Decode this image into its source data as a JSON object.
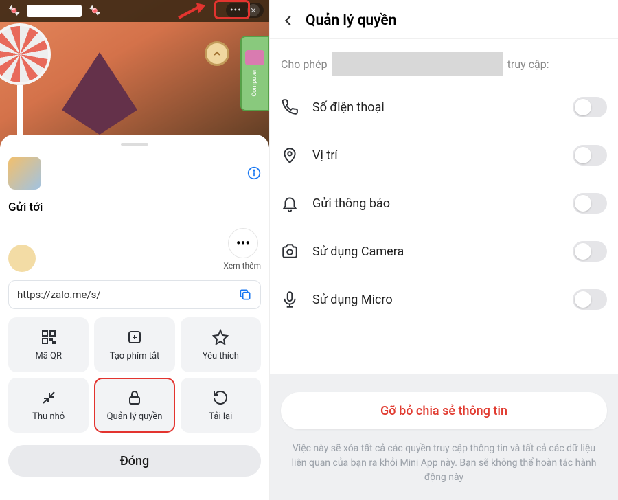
{
  "left": {
    "top_pill": {
      "menu": "•••",
      "close": "✕"
    },
    "side_tab_label": "Computer",
    "sheet": {
      "send_title": "Gửi tới",
      "more_label": "Xem thêm",
      "link_text": "https://zalo.me/s/",
      "tiles": [
        {
          "label": "Mã QR",
          "icon": "qr"
        },
        {
          "label": "Tạo phím tắt",
          "icon": "add-shortcut"
        },
        {
          "label": "Yêu thích",
          "icon": "star"
        },
        {
          "label": "Thu nhỏ",
          "icon": "minimize"
        },
        {
          "label": "Quản lý quyền",
          "icon": "lock"
        },
        {
          "label": "Tải lại",
          "icon": "reload"
        }
      ],
      "close_label": "Đóng"
    }
  },
  "right": {
    "title": "Quản lý quyền",
    "subtitle_prefix": "Cho phép",
    "subtitle_suffix": "truy cập:",
    "permissions": [
      {
        "label": "Số điện thoại",
        "icon": "phone",
        "on": false
      },
      {
        "label": "Vị trí",
        "icon": "location",
        "on": false
      },
      {
        "label": "Gửi thông báo",
        "icon": "bell",
        "on": false
      },
      {
        "label": "Sử dụng Camera",
        "icon": "camera",
        "on": false
      },
      {
        "label": "Sử dụng Micro",
        "icon": "mic",
        "on": false
      }
    ],
    "remove_label": "Gỡ bỏ chia sẻ thông tin",
    "disclaimer": "Việc này sẽ xóa tất cả các quyền truy cập thông tin và tất cả các dữ liệu liên quan của bạn ra khỏi Mini App này. Bạn sẽ không thể hoàn tác hành động này"
  }
}
